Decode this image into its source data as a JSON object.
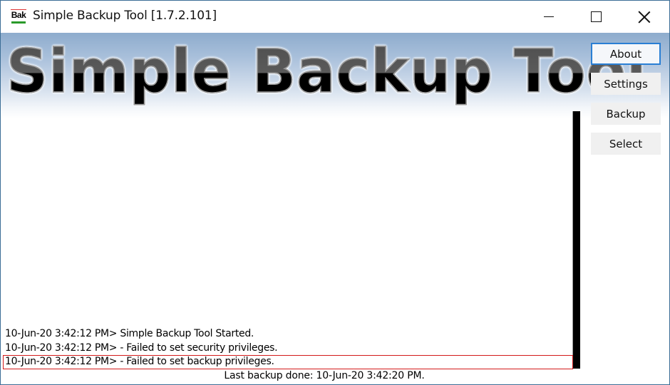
{
  "window": {
    "title": "Simple Backup Tool [1.7.2.101]",
    "icon_label": "Bak",
    "controls": {
      "minimize": "minimize-icon",
      "maximize": "maximize-icon",
      "close": "close-icon"
    }
  },
  "banner": {
    "text": "Simple Backup Tool"
  },
  "sidebar": {
    "buttons": [
      {
        "label": "About",
        "focused": true
      },
      {
        "label": "Settings"
      },
      {
        "label": "Backup"
      },
      {
        "label": "Select"
      }
    ]
  },
  "log": {
    "lines": [
      {
        "text": "10-Jun-20 3:42:12 PM> Simple Backup Tool Started."
      },
      {
        "text": "10-Jun-20 3:42:12 PM> - Failed to set security privileges."
      },
      {
        "text": "10-Jun-20 3:42:12 PM> - Failed to set backup privileges.",
        "selected": true
      }
    ]
  },
  "status": {
    "text": "Last backup done: 10-Jun-20 3:42:20 PM."
  },
  "colors": {
    "focus_border": "#2a7fd4",
    "selected_line_border": "#d31a1a",
    "banner_gradient_top": "#8eaccd"
  }
}
